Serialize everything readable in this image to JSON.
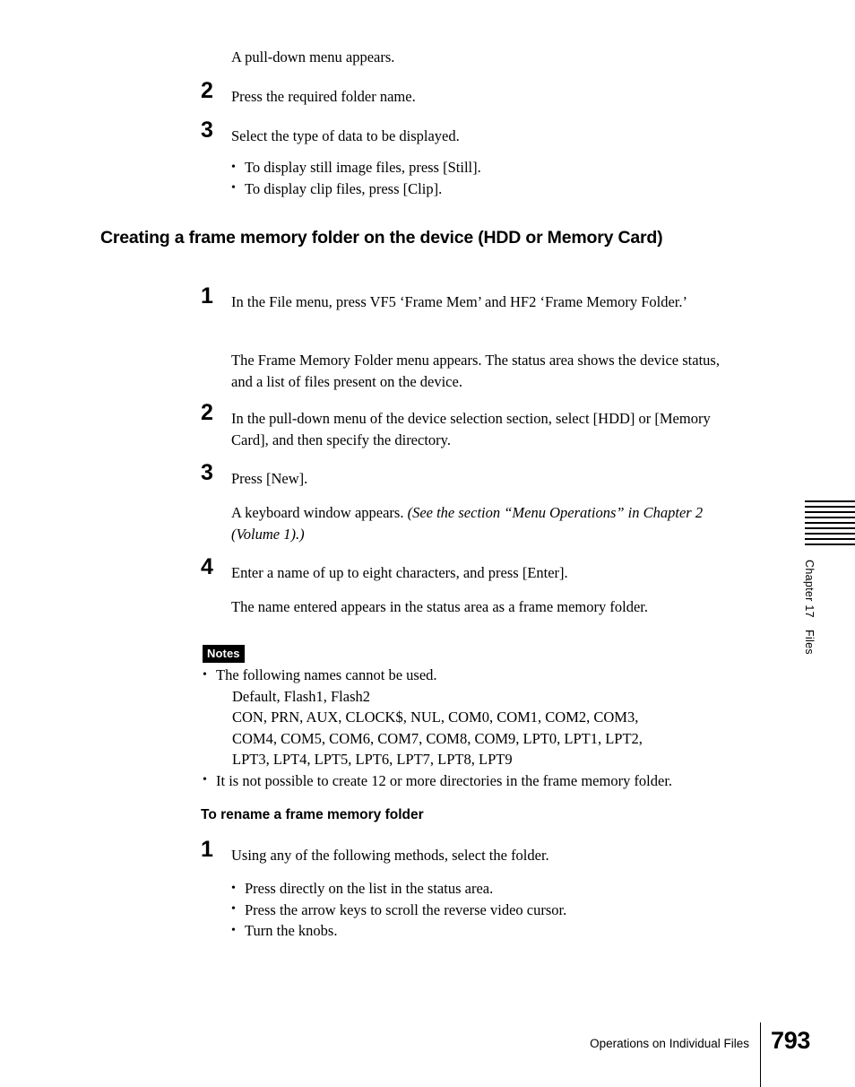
{
  "page": {
    "intro_line": "A pull-down menu appears.",
    "footer": {
      "section_label": "Operations on Individual Files",
      "page_number": "793"
    },
    "margin_tab": {
      "chapter_label": "Chapter 17",
      "chapter_topic": "Files",
      "stripe_count": 9
    }
  },
  "steps_top": [
    {
      "number": "2",
      "text": "Press the required folder name."
    },
    {
      "number": "3",
      "text": "Select the type of data to be displayed."
    }
  ],
  "display_bullets": [
    "To display still image files, press [Still].",
    "To display clip files, press [Clip]."
  ],
  "section": {
    "heading": "Creating a frame memory folder on the device (HDD or Memory Card)",
    "step1": {
      "number": "1",
      "text": "In the File menu, press VF5 ‘Frame Mem’ and HF2 ‘Frame Memory Folder.’",
      "result": "The Frame Memory Folder menu appears. The status area shows the device status, and a list of files present on the device."
    },
    "step2": {
      "number": "2",
      "text": "In the pull-down menu of the device selection section, select [HDD] or [Memory Card], and then specify the directory."
    },
    "step3": {
      "number": "3",
      "text": "Press [New].",
      "result_plain": "A keyboard window appears. ",
      "result_italic": "(See the section “Menu Operations” in Chapter 2 (Volume 1).)"
    },
    "step4": {
      "number": "4",
      "text": "Enter a name of up to eight characters, and press [Enter].",
      "result": "The name entered appears in the status area as a frame memory folder."
    }
  },
  "notes": {
    "badge": "Notes",
    "items": [
      {
        "text": "The following names cannot be used.",
        "sub_lines": [
          "Default, Flash1, Flash2",
          "CON, PRN, AUX, CLOCK$, NUL, COM0, COM1, COM2, COM3,",
          "COM4, COM5, COM6, COM7, COM8, COM9, LPT0, LPT1, LPT2,",
          "LPT3, LPT4, LPT5, LPT6, LPT7, LPT8, LPT9"
        ]
      },
      {
        "text": "It is not possible to create 12 or more directories in the frame memory folder.",
        "sub_lines": []
      }
    ]
  },
  "rename_section": {
    "heading": "To rename a frame memory folder",
    "step1": {
      "number": "1",
      "text": "Using any of the following methods, select the folder."
    },
    "methods": [
      "Press directly on the list in the status area.",
      "Press the arrow keys to scroll the reverse video cursor.",
      "Turn the knobs."
    ]
  }
}
